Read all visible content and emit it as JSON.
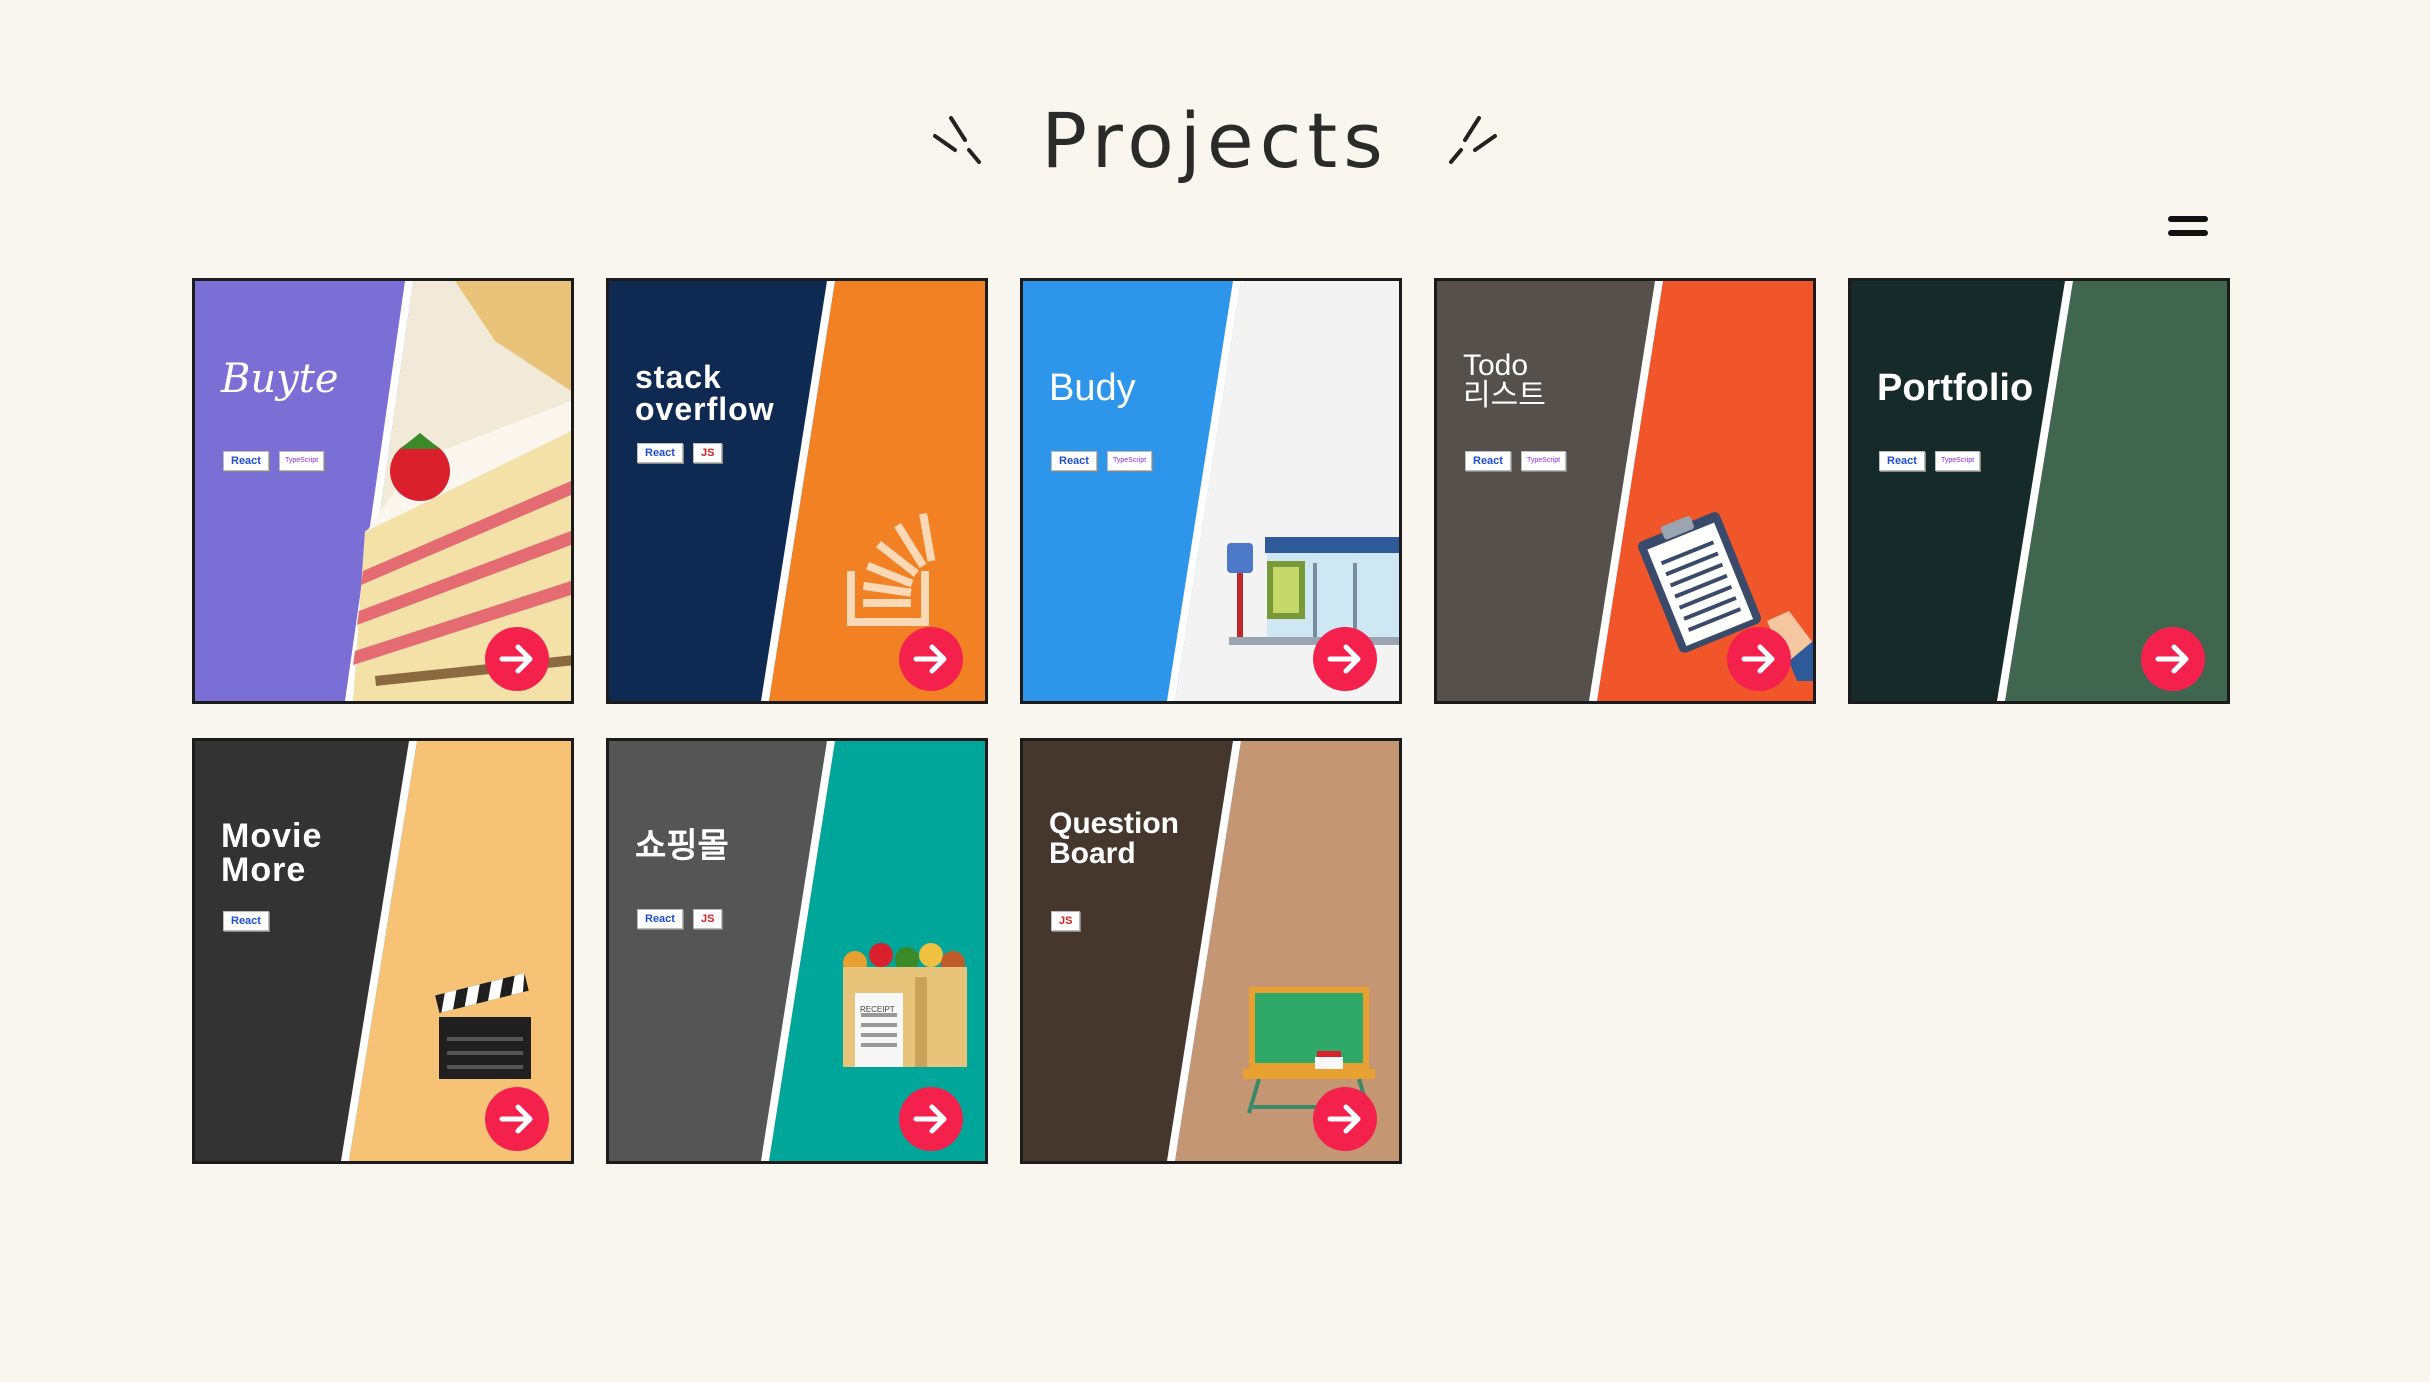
{
  "page": {
    "title": "Projects",
    "menu_icon": "hamburger-menu-icon",
    "colors": {
      "background": "#f9f6ef",
      "accent": "#f5214d"
    }
  },
  "projects": [
    {
      "title": "Buyte",
      "tags": [
        "React",
        "TypeScript"
      ],
      "left_color": "#7b6fd6",
      "right_color": "#f3e7cc",
      "illustration": "cake",
      "action_icon": "arrow-right-icon"
    },
    {
      "title": "stack\noverflow",
      "tags": [
        "React",
        "JS"
      ],
      "left_color": "#0f2a52",
      "right_color": "#f28123",
      "illustration": "stackoverflow-logo",
      "action_icon": "arrow-right-icon"
    },
    {
      "title": "Budy",
      "tags": [
        "React",
        "TypeScript"
      ],
      "left_color": "#2d96ea",
      "right_color": "#f3f3f3",
      "illustration": "bus-stop",
      "action_icon": "arrow-right-icon"
    },
    {
      "title": "Todo\n리스트",
      "tags": [
        "React",
        "TypeScript"
      ],
      "left_color": "#55504c",
      "right_color": "#f0562a",
      "illustration": "clipboard-todo",
      "action_icon": "arrow-right-icon"
    },
    {
      "title": "Portfolio",
      "tags": [
        "React",
        "TypeScript"
      ],
      "left_color": "#172a2a",
      "right_color": "#406650",
      "illustration": "",
      "action_icon": "arrow-right-icon"
    },
    {
      "title": "Movie\nMore",
      "tags": [
        "React"
      ],
      "left_color": "#333333",
      "right_color": "#f6c275",
      "illustration": "clapperboard",
      "action_icon": "arrow-right-icon"
    },
    {
      "title": "쇼핑몰",
      "tags": [
        "React",
        "JS"
      ],
      "left_color": "#555555",
      "right_color": "#00a699",
      "illustration": "grocery-bag",
      "receipt_text": "RECEIPT",
      "action_icon": "arrow-right-icon"
    },
    {
      "title": "Question\nBoard",
      "tags": [
        "JS"
      ],
      "left_color": "#45372d",
      "right_color": "#c49673",
      "illustration": "chalkboard",
      "action_icon": "arrow-right-icon"
    }
  ]
}
